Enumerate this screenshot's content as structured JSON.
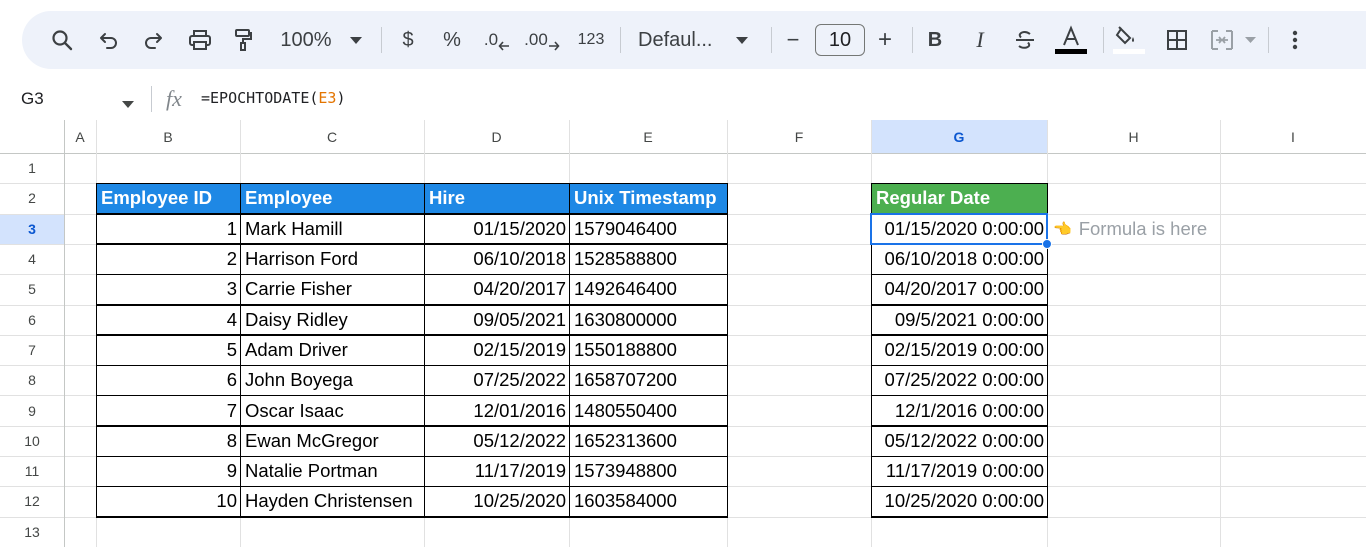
{
  "toolbar": {
    "zoom": "100%",
    "currency_label": "$",
    "percent_label": "%",
    "decrease_decimals_label": ".0",
    "increase_decimals_label": ".00",
    "number_format_label": "123",
    "font_name": "Defaul...",
    "font_size": "10",
    "minus_label": "−",
    "plus_label": "+",
    "bold_label": "B",
    "italic_label": "I"
  },
  "formula_bar": {
    "cell_ref": "G3",
    "formula_prefix": "=EPOCHTODATE(",
    "formula_ref": "E3",
    "formula_suffix": ")"
  },
  "columns": [
    "A",
    "B",
    "C",
    "D",
    "E",
    "F",
    "G",
    "H",
    "I"
  ],
  "rows": [
    "1",
    "2",
    "3",
    "4",
    "5",
    "6",
    "7",
    "8",
    "9",
    "10",
    "11",
    "12",
    "13"
  ],
  "selected_cell": {
    "column": "G",
    "row": "3"
  },
  "table": {
    "headers": [
      "Employee ID",
      "Employee",
      "Hire",
      "Unix Timestamp"
    ],
    "rows": [
      [
        "1",
        "Mark Hamill",
        "01/15/2020",
        "1579046400"
      ],
      [
        "2",
        "Harrison Ford",
        "06/10/2018",
        "1528588800"
      ],
      [
        "3",
        "Carrie Fisher",
        "04/20/2017",
        "1492646400"
      ],
      [
        "4",
        "Daisy Ridley",
        "09/05/2021",
        "1630800000"
      ],
      [
        "5",
        "Adam Driver",
        "02/15/2019",
        "1550188800"
      ],
      [
        "6",
        "John Boyega",
        "07/25/2022",
        "1658707200"
      ],
      [
        "7",
        "Oscar Isaac",
        "12/01/2016",
        "1480550400"
      ],
      [
        "8",
        "Ewan McGregor",
        "05/12/2022",
        "1652313600"
      ],
      [
        "9",
        "Natalie Portman",
        "11/17/2019",
        "1573948800"
      ],
      [
        "10",
        "Hayden Christensen",
        "10/25/2020",
        "1603584000"
      ]
    ]
  },
  "result": {
    "header": "Regular Date",
    "values": [
      "01/15/2020 0:00:00",
      "06/10/2018 0:00:00",
      "04/20/2017 0:00:00",
      "09/5/2021 0:00:00",
      "02/15/2019 0:00:00",
      "07/25/2022 0:00:00",
      "12/1/2016 0:00:00",
      "05/12/2022 0:00:00",
      "11/17/2019 0:00:00",
      "10/25/2020 0:00:00"
    ]
  },
  "annotation": {
    "text": "Formula is here",
    "icon": "pointing-hand-icon"
  },
  "colors": {
    "header_blue": "#1e88e5",
    "header_green": "#4caf50",
    "selection": "#1a73e8",
    "formula_ref": "#e37400"
  }
}
